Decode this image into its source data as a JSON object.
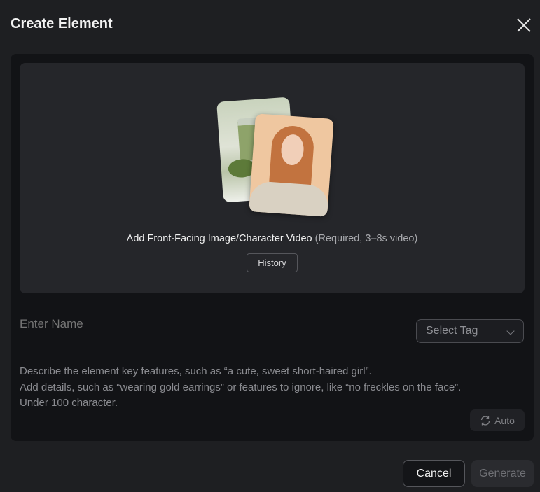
{
  "dialog": {
    "title": "Create Element"
  },
  "upload": {
    "label": "Add Front-Facing Image/Character Video",
    "hint": "(Required, 3–8s video)",
    "history_label": "History"
  },
  "form": {
    "name_placeholder": "Enter Name",
    "tag_placeholder": "Select Tag",
    "description_placeholder": [
      "Describe the element key features, such as “a cute, sweet short-haired girl”.",
      "Add details, such as “wearing gold earrings” or features to ignore, like “no freckles on the face”.",
      "Under 100 character."
    ],
    "auto_label": "Auto"
  },
  "footer": {
    "cancel_label": "Cancel",
    "generate_label": "Generate"
  }
}
